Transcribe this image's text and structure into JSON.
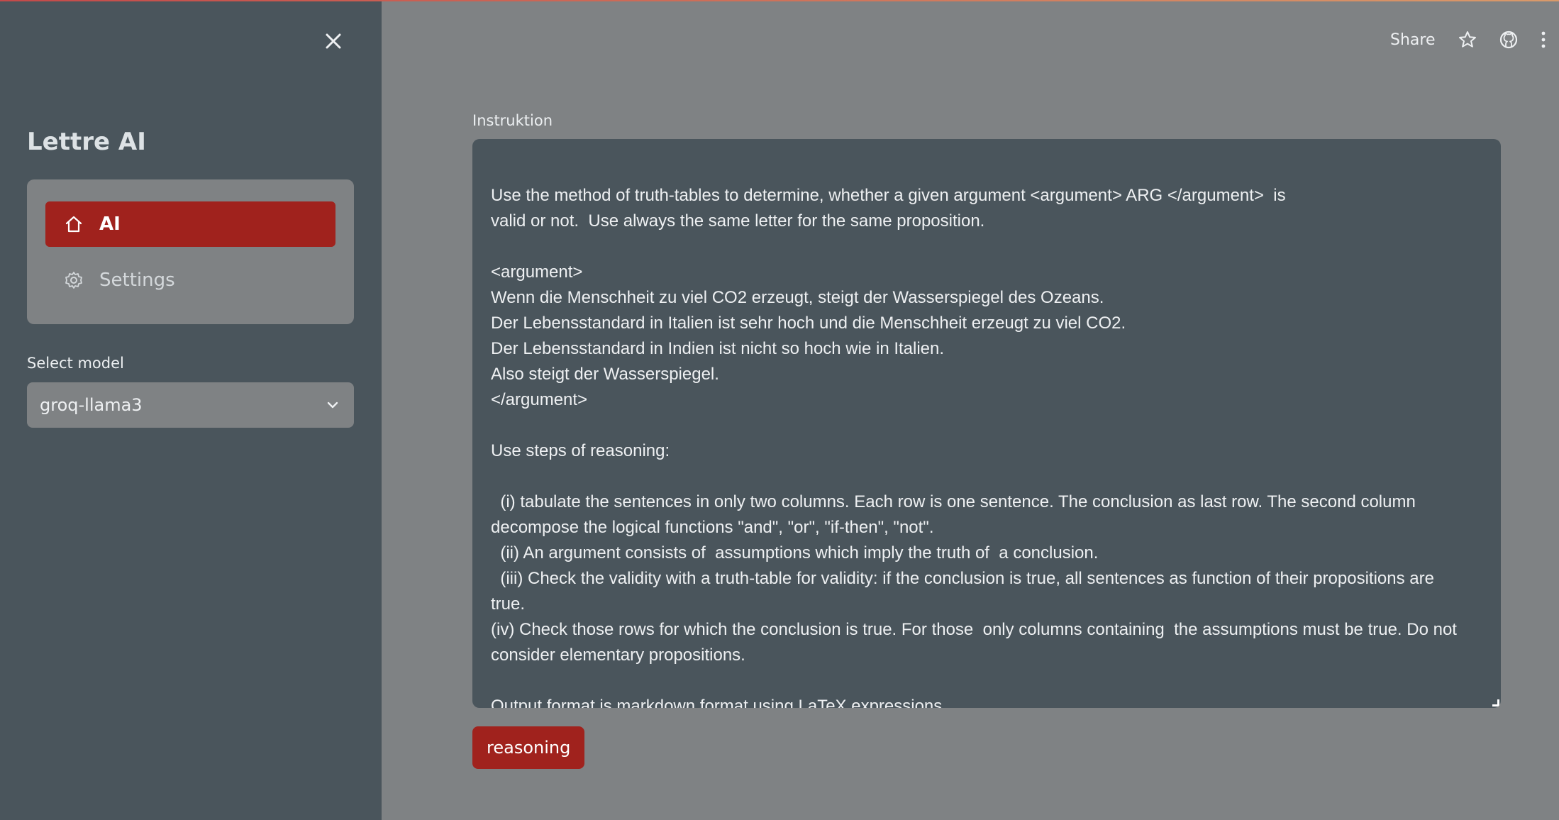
{
  "sidebar": {
    "app_title": "Lettre AI",
    "nav": [
      {
        "label": "AI",
        "icon": "home-icon",
        "active": true
      },
      {
        "label": "Settings",
        "icon": "gear-icon",
        "active": false
      }
    ],
    "model_label": "Select model",
    "model_value": "groq-llama3"
  },
  "header": {
    "share_label": "Share"
  },
  "main": {
    "field_label": "Instruktion",
    "instruction_text": "Use the method of truth-tables to determine, whether a given argument <argument> ARG </argument>  is\nvalid or not.  Use always the same letter for the same proposition.\n\n<argument>\nWenn die Menschheit zu viel CO2 erzeugt, steigt der Wasserspiegel des Ozeans.\nDer Lebensstandard in Italien ist sehr hoch und die Menschheit erzeugt zu viel CO2.\nDer Lebensstandard in Indien ist nicht so hoch wie in Italien.\nAlso steigt der Wasserspiegel.\n</argument>\n\nUse steps of reasoning:\n\n  (i) tabulate the sentences in only two columns. Each row is one sentence. The conclusion as last row. The second column\ndecompose the logical functions \"and\", \"or\", \"if-then\", \"not\".\n  (ii) An argument consists of  assumptions which imply the truth of  a conclusion.\n  (iii) Check the validity with a truth-table for validity: if the conclusion is true, all sentences as function of their propositions are\ntrue.\n(iv) Check those rows for which the conclusion is true. For those  only columns containing  the assumptions must be true. Do not\nconsider elementary propositions.\n\nOutput format is markdown format using LaTeX expressions.",
    "button_label": "reasoning"
  },
  "colors": {
    "accent": "#a0221d",
    "sidebar_bg": "#4a555c",
    "main_bg": "#7f8284"
  }
}
